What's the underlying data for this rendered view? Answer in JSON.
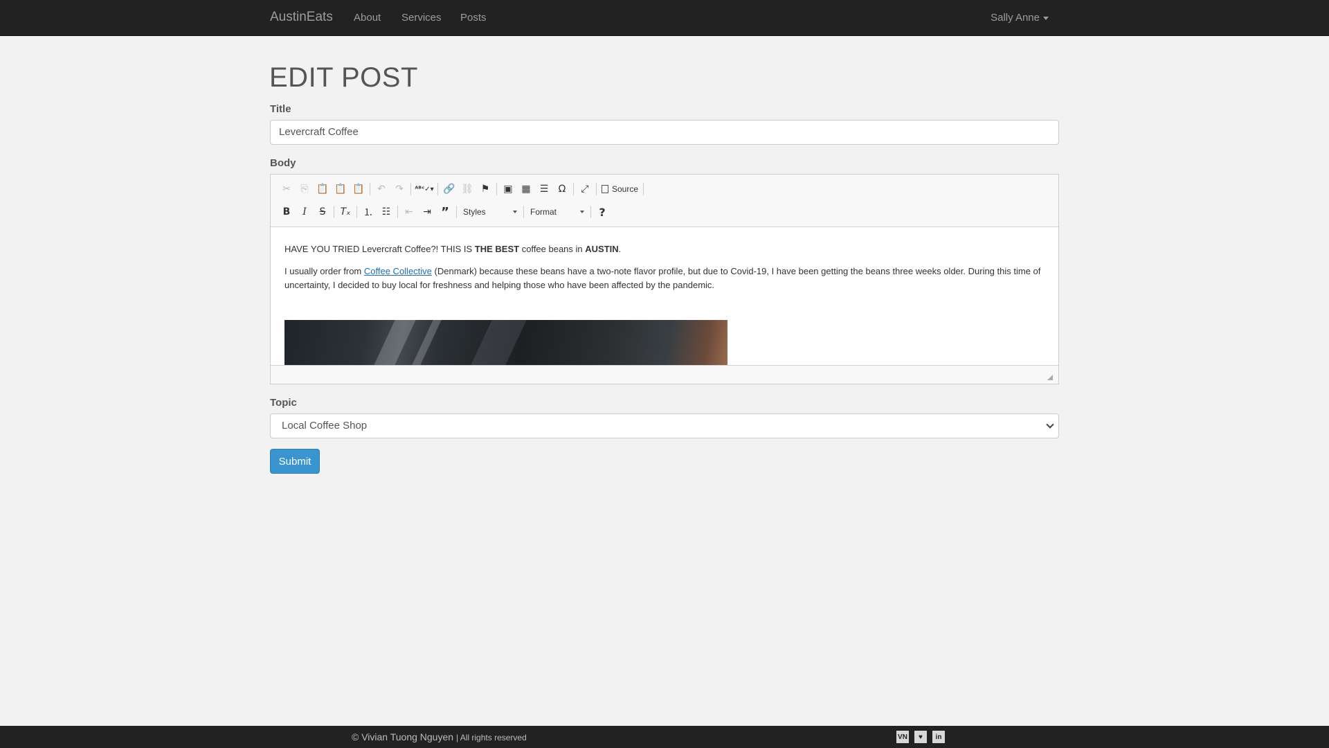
{
  "navbar": {
    "brand": "AustinEats",
    "links": [
      "About",
      "Services",
      "Posts"
    ],
    "user": "Sally Anne"
  },
  "page": {
    "title": "EDIT POST"
  },
  "form": {
    "title_label": "Title",
    "title_value": "Levercraft Coffee",
    "body_label": "Body",
    "topic_label": "Topic",
    "topic_value": "Local Coffee Shop",
    "submit_label": "Submit"
  },
  "editor": {
    "toolbar": {
      "source_label": "Source",
      "styles_label": "Styles",
      "format_label": "Format",
      "icons_row1": [
        "cut-icon",
        "copy-icon",
        "paste-icon",
        "paste-text-icon",
        "paste-word-icon",
        "undo-icon",
        "redo-icon",
        "spellcheck-icon",
        "link-icon",
        "unlink-icon",
        "anchor-icon",
        "image-icon",
        "table-icon",
        "horizontal-line-icon",
        "special-char-icon",
        "maximize-icon",
        "source-icon"
      ],
      "icons_row2": [
        "bold-icon",
        "italic-icon",
        "strike-icon",
        "remove-format-icon",
        "numbered-list-icon",
        "bulleted-list-icon",
        "outdent-icon",
        "indent-icon",
        "blockquote-icon",
        "help-icon"
      ]
    },
    "content": {
      "p1_a": "HAVE YOU TRIED Levercraft Coffee?! THIS IS ",
      "p1_b": "THE BEST",
      "p1_c": " coffee beans in ",
      "p1_d": "AUSTIN",
      "p1_e": ".",
      "p2_a": "I usually order from ",
      "p2_link": "Coffee Collective",
      "p2_b": " (Denmark) because these beans have a two-note flavor profile, but due to Covid-19, I have been getting the beans three weeks older. During this time of uncertainty, I decided to buy local for freshness and helping those who have been affected by the pandemic."
    }
  },
  "footer": {
    "copyright": "© Vivian Tuong Nguyen",
    "rights": "| All rights reserved",
    "social": [
      "VN",
      "♥",
      "in"
    ]
  },
  "colors": {
    "navbar_bg": "#222222",
    "page_bg": "#f2f2f2",
    "primary_button": "#3a95cf",
    "link": "#1f6fb2"
  }
}
